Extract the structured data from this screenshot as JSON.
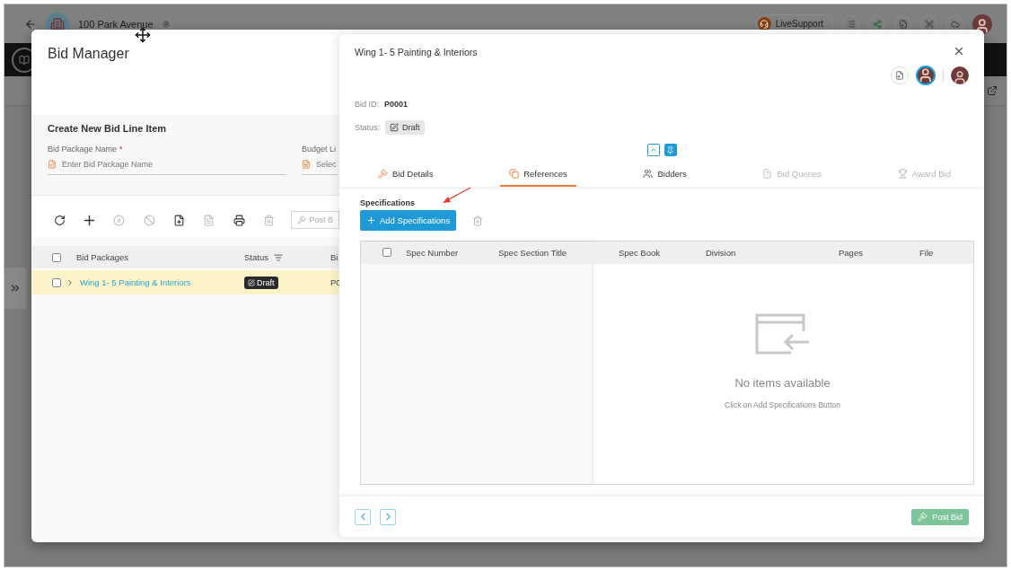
{
  "app_bar": {
    "project": "100 Park Avenue",
    "live_support": "LiveSupport"
  },
  "dialog": {
    "title": "Bid Manager",
    "create_section": {
      "title": "Create New Bid Line Item",
      "fields": [
        {
          "label": "Bid Package Name",
          "required_mark": "*",
          "placeholder": "Enter Bid Package Name",
          "kind": "package"
        },
        {
          "label": "Budget Li",
          "placeholder": "Selec",
          "kind": "budget"
        }
      ]
    },
    "tools": [
      {
        "kind": "refresh",
        "disabled": false
      },
      {
        "kind": "add",
        "disabled": false
      },
      {
        "kind": "pause",
        "disabled": true
      },
      {
        "kind": "block",
        "disabled": true
      },
      {
        "kind": "file",
        "disabled": false
      },
      {
        "kind": "pdf",
        "disabled": true
      },
      {
        "kind": "print",
        "disabled": false
      },
      {
        "kind": "delete",
        "disabled": true
      }
    ],
    "post_button": "Post B",
    "table": {
      "all_checked": false,
      "columns": [
        "Bid Packages",
        "Status",
        "Bi"
      ],
      "rows": [
        {
          "name": "Wing 1- 5 Painting & Interiors",
          "status": "Draft",
          "column_3": "P0",
          "selected": true,
          "checked": false
        }
      ]
    }
  },
  "detail": {
    "title": "Wing 1- 5 Painting & Interiors",
    "bid_id_label": "Bid ID:",
    "bid_id": "P0001",
    "status_label": "Status:",
    "status": "Draft",
    "tabs": [
      {
        "label": "Bid Details",
        "kind": "gavel",
        "selected": false,
        "disabled": false
      },
      {
        "label": "References",
        "kind": "references",
        "selected": true,
        "disabled": false
      },
      {
        "label": "Bidders",
        "kind": "bidders",
        "selected": false,
        "disabled": false
      },
      {
        "label": "Bid Queries",
        "kind": "queries",
        "selected": false,
        "disabled": true
      },
      {
        "label": "Award Bid",
        "kind": "trophy",
        "selected": false,
        "disabled": true
      }
    ],
    "section_title": "Specifications",
    "add_button": "Add Specifications",
    "grid": {
      "all_checked": false,
      "pinned_columns": [
        "Spec Number",
        "Spec Section Title"
      ],
      "columns": [
        "Spec Book",
        "Division",
        "Pages",
        "File"
      ]
    },
    "empty": {
      "title": "No items available",
      "hint": "Click on Add Specifications Button"
    },
    "post_button": {
      "label": "Post Bid",
      "disabled": true
    }
  }
}
